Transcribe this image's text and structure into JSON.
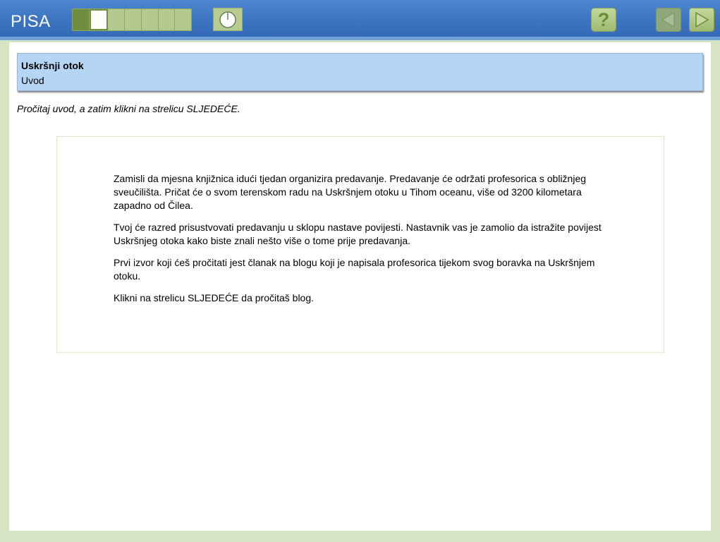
{
  "app": {
    "logo": "PISA"
  },
  "progress": {
    "total_segments": 7,
    "completed": 1,
    "current_index": 1
  },
  "toolbar": {
    "timer_icon": "clock-icon",
    "help_label": "?",
    "prev_icon": "arrow-left-icon",
    "next_icon": "arrow-right-icon"
  },
  "unit": {
    "title": "Uskršnji otok",
    "subtitle": "Uvod"
  },
  "instruction": "Pročitaj uvod, a zatim klikni na strelicu SLJEDEĆE.",
  "passage": {
    "paragraphs": [
      "Zamisli da mjesna knjižnica idući tjedan organizira predavanje. Predavanje će održati profesorica s obližnjeg sveučilišta. Pričat će o svom terenskom radu na Uskršnjem otoku u Tihom oceanu, više od 3200 kilometara zapadno od Čilea.",
      "Tvoj će razred prisustvovati predavanju u sklopu nastave povijesti. Nastavnik vas je zamolio da istražite povijest Uskršnjeg otoka kako biste znali nešto više o tome prije predavanja.",
      "Prvi izvor koji ćeš pročitati jest članak na blogu koji je napisala profesorica tijekom svog boravka na Uskršnjem otoku.",
      "Klikni na strelicu SLJEDEĆE da pročitaš blog."
    ]
  },
  "colors": {
    "topbar": "#3f76c3",
    "accent_green": "#b3ca8c",
    "progress_done": "#6f8c3f",
    "header_box": "#b4d5f3",
    "frame": "#d7e4c4"
  }
}
